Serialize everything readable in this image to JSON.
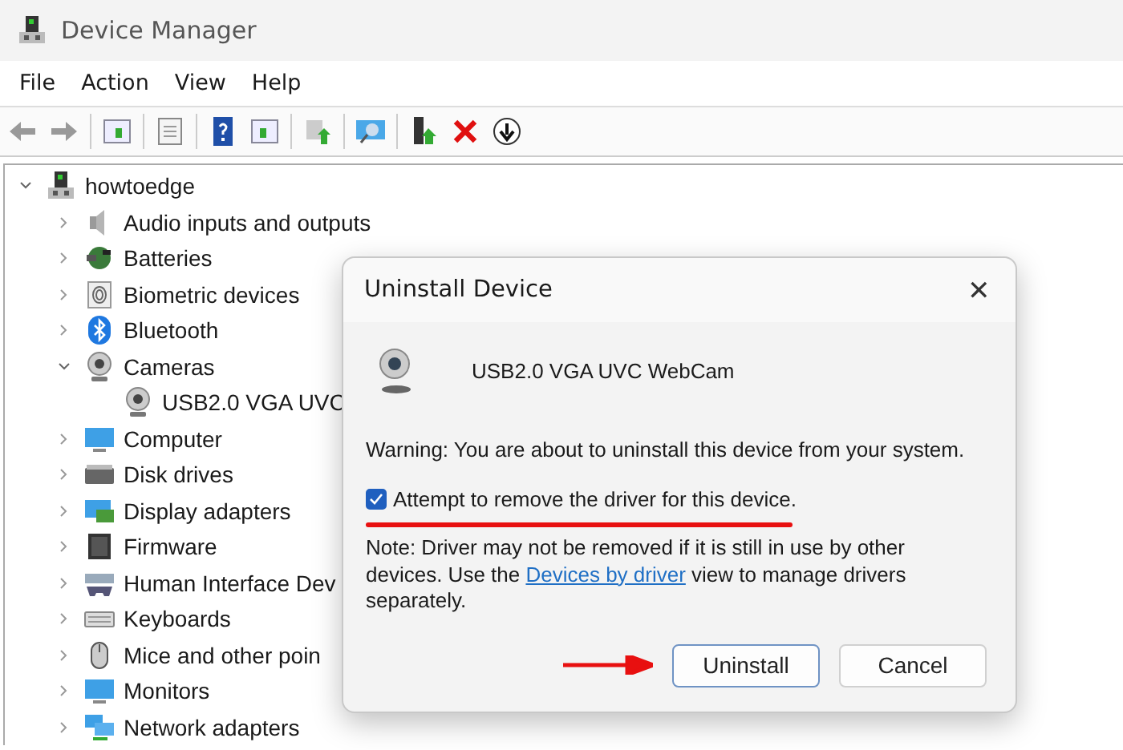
{
  "window": {
    "title": "Device Manager"
  },
  "menu": [
    "File",
    "Action",
    "View",
    "Help"
  ],
  "tree": {
    "label": "howtoedge",
    "expanded": true,
    "children": [
      {
        "label": "Audio inputs and outputs",
        "expanded": false
      },
      {
        "label": "Batteries",
        "expanded": false
      },
      {
        "label": "Biometric devices",
        "expanded": false
      },
      {
        "label": "Bluetooth",
        "expanded": false
      },
      {
        "label": "Cameras",
        "expanded": true,
        "children": [
          {
            "label": "USB2.0 VGA UVC"
          }
        ]
      },
      {
        "label": "Computer",
        "expanded": false
      },
      {
        "label": "Disk drives",
        "expanded": false
      },
      {
        "label": "Display adapters",
        "expanded": false
      },
      {
        "label": "Firmware",
        "expanded": false
      },
      {
        "label": "Human Interface Dev",
        "expanded": false
      },
      {
        "label": "Keyboards",
        "expanded": false
      },
      {
        "label": "Mice and other poin",
        "expanded": false
      },
      {
        "label": "Monitors",
        "expanded": false
      },
      {
        "label": "Network adapters",
        "expanded": false
      }
    ]
  },
  "dialog": {
    "title": "Uninstall Device",
    "close": "✕",
    "device_name": "USB2.0 VGA UVC WebCam",
    "warning": "Warning: You are about to uninstall this device from your system.",
    "checkbox": {
      "label": "Attempt to remove the driver for this device.",
      "checked": true
    },
    "note": {
      "before": "Note: Driver may not be removed if it is still in use by other devices. Use the ",
      "link": "Devices by driver",
      "after": " view to manage drivers separately."
    },
    "buttons": [
      {
        "label": "Uninstall",
        "default": true
      },
      {
        "label": "Cancel",
        "default": false
      }
    ]
  }
}
